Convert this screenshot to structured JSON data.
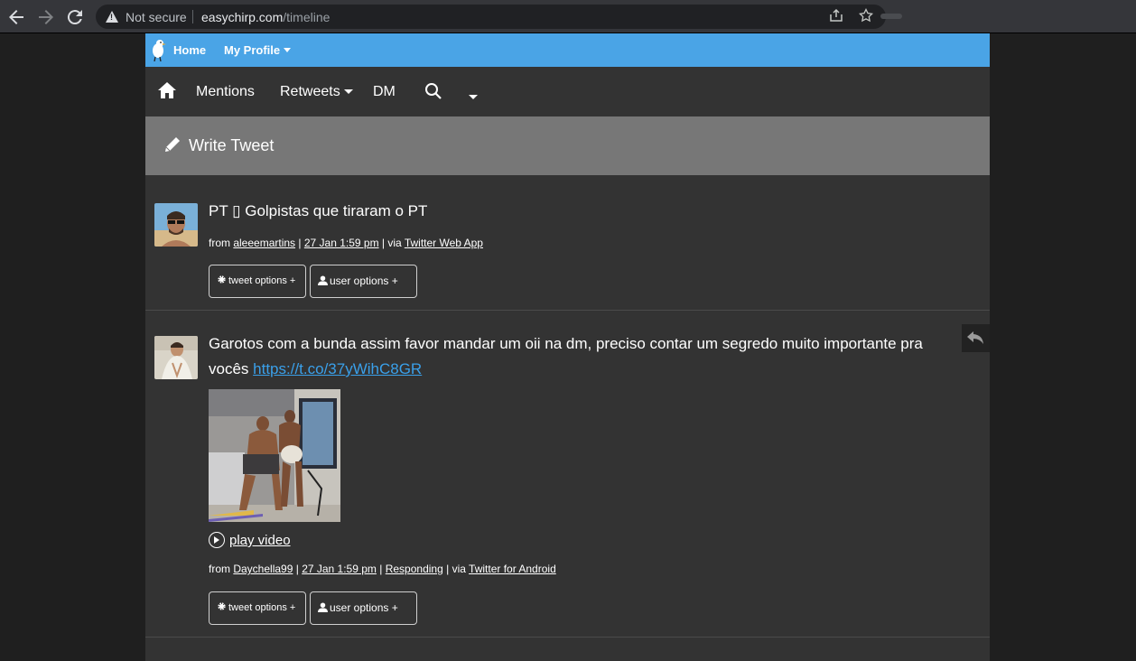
{
  "browser": {
    "security_label": "Not secure",
    "url_domain": "easychirp.com",
    "url_path": "/timeline"
  },
  "topbar": {
    "home_label": "Home",
    "profile_label": "My Profile"
  },
  "nav": {
    "mentions": "Mentions",
    "retweets": "Retweets",
    "dm": "DM"
  },
  "write": {
    "label": "Write Tweet"
  },
  "tweets": [
    {
      "text": "PT ▯ Golpistas que tiraram o PT",
      "from_prefix": "from ",
      "user": "aleeemartins",
      "sep1": " | ",
      "time": "27 Jan 1:59 pm",
      "sep2": " | via ",
      "client": "Twitter Web App",
      "tweet_options": "tweet options +",
      "user_options": "user options +"
    },
    {
      "text_line1": "Garotos com a bunda assim favor mandar um oii na dm, preciso contar um segredo muito importante pra",
      "text_line2": "vocês ",
      "link": "https://t.co/37yWihC8GR",
      "play_label": "play video",
      "from_prefix": "from ",
      "user": "Daychella99",
      "sep1": " | ",
      "time": "27 Jan 1:59 pm",
      "sep2": " | ",
      "responding": "Responding",
      "sep3": " | via ",
      "client": "Twitter for Android",
      "tweet_options": "tweet options +",
      "user_options": "user options +"
    }
  ],
  "colors": {
    "topbar": "#4aa4e6",
    "page_bg": "#333333",
    "write_bar": "#777777",
    "link": "#3aa0ea"
  }
}
